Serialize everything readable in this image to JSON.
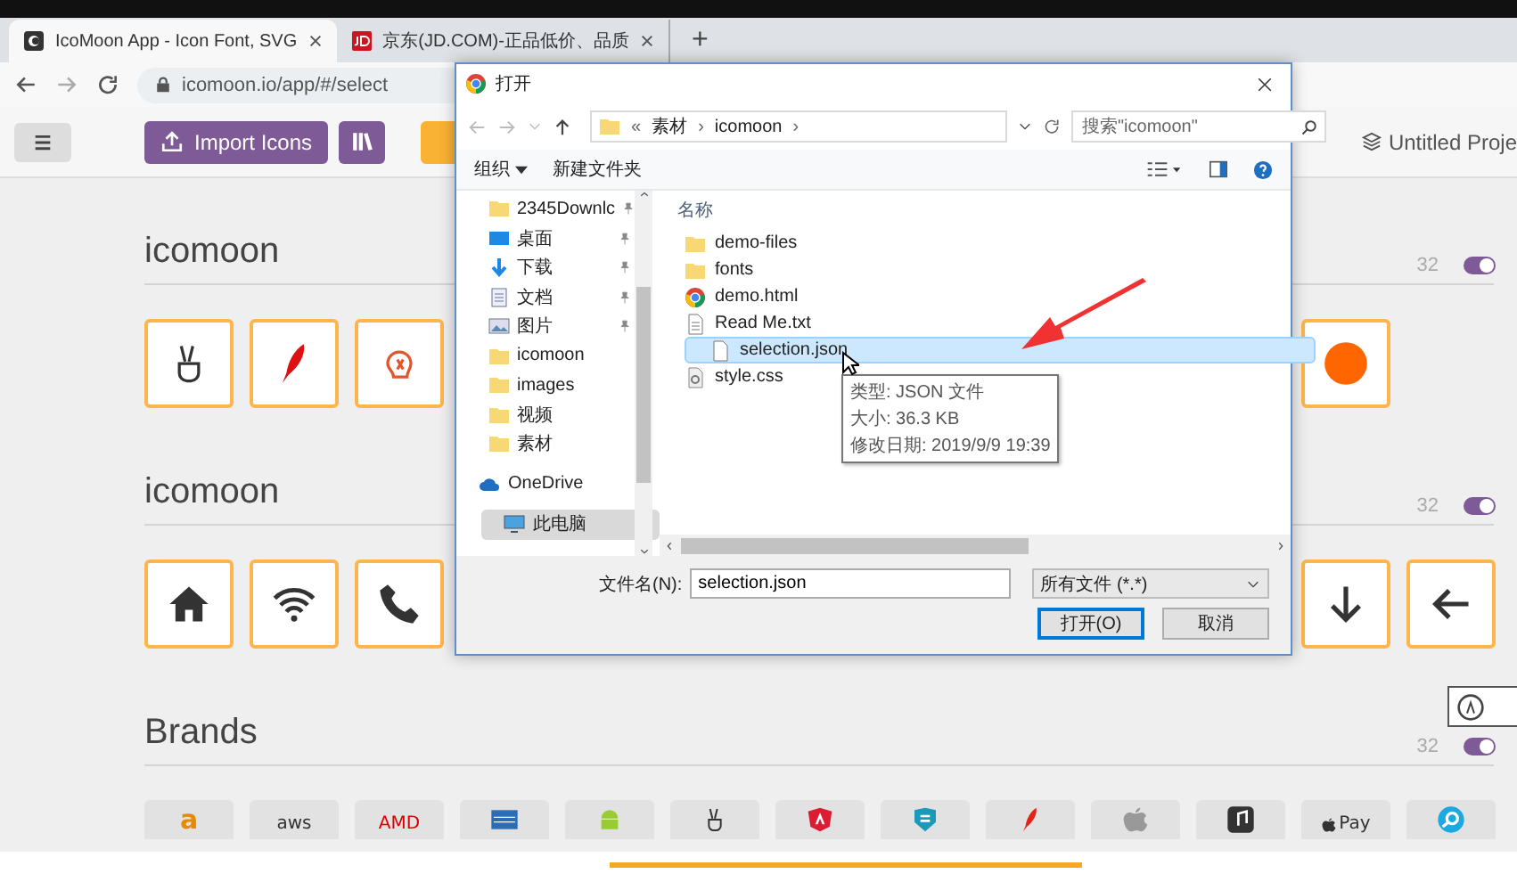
{
  "browser": {
    "tabs": [
      {
        "title": "IcoMoon App - Icon Font, SVG",
        "selected": true
      },
      {
        "title": "京东(JD.COM)-正品低价、品质",
        "selected": false
      }
    ],
    "new_tab": "+",
    "address": "icomoon.io/app/#/select"
  },
  "toolbar": {
    "import_button": "Import Icons",
    "project": "Untitled Proje"
  },
  "sets": [
    {
      "title": "icomoon",
      "count": "32",
      "on": true,
      "left_icons": [
        {
          "selected": true
        },
        {
          "selected": true
        },
        {
          "selected": true
        }
      ],
      "right_icons": [
        {
          "selected": true
        }
      ]
    },
    {
      "title": "icomoon",
      "count": "32",
      "on": true,
      "left_icons": [
        {
          "selected": true
        },
        {
          "selected": true
        },
        {
          "selected": true
        }
      ],
      "right_icons": [
        {
          "selected": true
        },
        {
          "selected": true
        }
      ]
    },
    {
      "title": "Brands",
      "count": "32",
      "on": true,
      "left_icons": [
        {
          "selected": false,
          "label": "a"
        },
        {
          "selected": false,
          "label": "aws"
        },
        {
          "selected": false,
          "label": "AMD"
        },
        {
          "selected": false
        },
        {
          "selected": false
        },
        {
          "selected": false
        },
        {
          "selected": false
        },
        {
          "selected": false
        },
        {
          "selected": false
        },
        {
          "selected": false
        },
        {
          "selected": false
        },
        {
          "selected": false,
          "label": "Pay"
        },
        {
          "selected": false
        }
      ]
    }
  ],
  "dialog": {
    "title": "打开",
    "path_prefix": "«",
    "path": [
      {
        "name": "素材",
        "sep": "›"
      },
      {
        "name": "icomoon",
        "sep": "›"
      }
    ],
    "search": {
      "placeholder": "搜索\"icomoon\""
    },
    "commands": [
      "组织",
      "新建文件夹"
    ],
    "nav": [
      {
        "name": "2345Downlc",
        "kind": "folder",
        "pinned": true,
        "selected": false
      },
      {
        "name": "桌面",
        "kind": "desktop",
        "pinned": true,
        "selected": false
      },
      {
        "name": "下载",
        "kind": "download",
        "pinned": true,
        "selected": false
      },
      {
        "name": "文档",
        "kind": "document",
        "pinned": true,
        "selected": false
      },
      {
        "name": "图片",
        "kind": "picture",
        "pinned": true,
        "selected": false
      },
      {
        "name": "icomoon",
        "kind": "folder",
        "pinned": false,
        "selected": false
      },
      {
        "name": "images",
        "kind": "folder",
        "pinned": false,
        "selected": false
      },
      {
        "name": "视频",
        "kind": "folder",
        "pinned": false,
        "selected": false
      },
      {
        "name": "素材",
        "kind": "folder",
        "pinned": false,
        "selected": false
      },
      {
        "name": "OneDrive",
        "kind": "cloud",
        "pinned": false,
        "selected": false
      },
      {
        "name": "此电脑",
        "kind": "computer",
        "pinned": false,
        "selected": true
      }
    ],
    "column": "名称",
    "files": [
      {
        "name": "demo-files",
        "kind": "folder",
        "selected": false
      },
      {
        "name": "fonts",
        "kind": "folder",
        "selected": false
      },
      {
        "name": "demo.html",
        "kind": "html",
        "selected": false
      },
      {
        "name": "Read Me.txt",
        "kind": "text",
        "selected": false
      },
      {
        "name": "selection.json",
        "kind": "file",
        "selected": true
      },
      {
        "name": "style.css",
        "kind": "css",
        "selected": false
      }
    ],
    "tooltip": [
      "类型: JSON 文件",
      "大小: 36.3 KB",
      "修改日期: 2019/9/9 19:39"
    ],
    "filename_label": "文件名(N):",
    "filename": "selection.json",
    "filetype": "所有文件 (*.*)",
    "buttons": [
      {
        "label": "打开(O)",
        "kind": "primary"
      },
      {
        "label": "取消",
        "kind": "normal"
      }
    ]
  }
}
